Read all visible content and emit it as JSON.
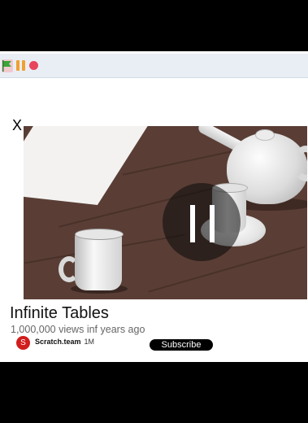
{
  "controls": {
    "green_flag_icon": "green-flag-icon",
    "pause_icon": "pause-icon",
    "stop_icon": "stop-icon",
    "colors": {
      "flag": "#3aa53a",
      "pause": "#f0a030",
      "stop": "#e8455b"
    }
  },
  "player": {
    "close_label": "X",
    "video": {
      "title": "Infinite Tables",
      "views": "1,000,000 views",
      "age": "inf years ago",
      "channel": {
        "avatar_letter": "S",
        "name": "Scratch.team",
        "subscribers": "1M"
      },
      "subscribe_label": "Subscribe",
      "state": "paused"
    }
  }
}
